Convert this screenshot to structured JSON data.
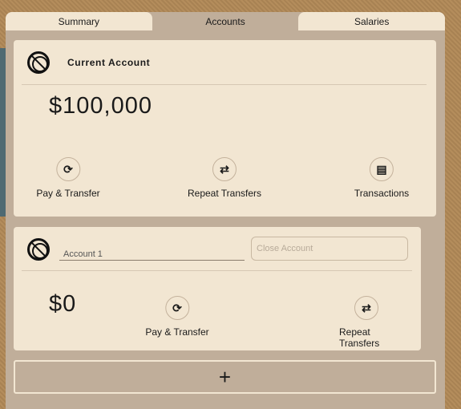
{
  "tabs": [
    {
      "label": "Summary"
    },
    {
      "label": "Accounts",
      "active": true
    },
    {
      "label": "Salaries"
    }
  ],
  "current_account": {
    "title": "Current Account",
    "balance": "$100,000",
    "actions": [
      {
        "label": "Pay & Transfer",
        "icon": "sync-icon"
      },
      {
        "label": "Repeat Transfers",
        "icon": "repeat-icon"
      },
      {
        "label": "Transactions",
        "icon": "receipt-icon"
      }
    ]
  },
  "account1": {
    "name_value": "Account 1",
    "close_placeholder": "Close Account",
    "balance": "$0",
    "actions": [
      {
        "label": "Pay & Transfer",
        "icon": "sync-icon"
      },
      {
        "label": "Repeat Transfers",
        "icon": "repeat-icon"
      }
    ]
  },
  "add_label": "+",
  "colors": {
    "panel": "#c0ae9a",
    "card": "#f2e6d2"
  }
}
